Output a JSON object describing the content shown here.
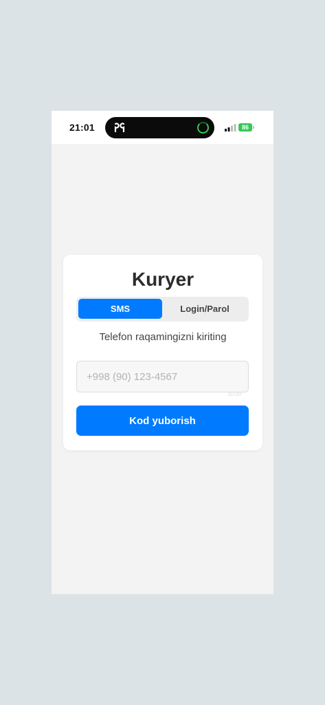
{
  "status_bar": {
    "time": "21:01",
    "battery": "86"
  },
  "login_card": {
    "title": "Kuryer",
    "tabs": [
      {
        "label": "SMS",
        "active": true
      },
      {
        "label": "Login/Parol",
        "active": false
      }
    ],
    "subtitle": "Telefon raqamingizni kiriting",
    "phone_input": {
      "placeholder": "+998 (90) 123-4567",
      "value": ""
    },
    "ghost_hint": "10:00",
    "submit_label": "Kod yuborish"
  },
  "colors": {
    "accent": "#007bff",
    "battery": "#34c759",
    "background": "#dbe3e6"
  }
}
